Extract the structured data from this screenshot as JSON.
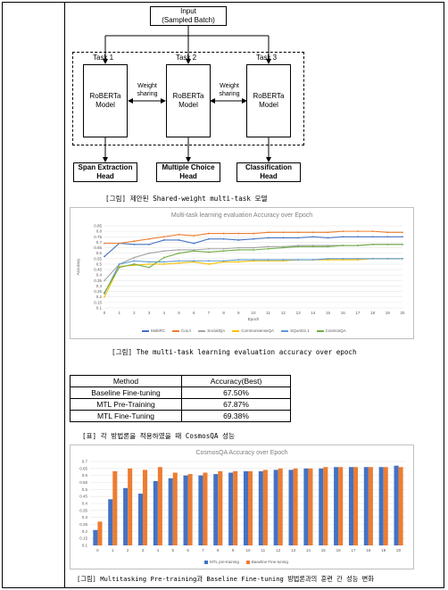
{
  "diagram": {
    "input_label": "Input\n(Sampled Batch)",
    "tasks": [
      {
        "task_label": "Task 1",
        "model_label": "RoBERTa\nModel",
        "head_label": "Span Extraction\nHead"
      },
      {
        "task_label": "Task 2",
        "model_label": "RoBERTa\nModel",
        "head_label": "Multiple Choice\nHead"
      },
      {
        "task_label": "Task 3",
        "model_label": "RoBERTa\nModel",
        "head_label": "Classification\nHead"
      }
    ],
    "weight_sharing_label": "Weight\nsharing",
    "caption": "[그림] 제안된 Shared-weight multi-task 모델"
  },
  "chart1_caption": "[그림] The multi-task learning evaluation accuracy over epoch",
  "table": {
    "headers": [
      "Method",
      "Accuracy(Best)"
    ],
    "rows": [
      [
        "Baseline Fine-tuning",
        "67.50%"
      ],
      [
        "MTL Pre-Training",
        "67.87%"
      ],
      [
        "MTL Fine-Tuning",
        "69.38%"
      ]
    ],
    "caption": "[표] 각 방법론을 적용하였을 때 CosmosQA 성능"
  },
  "chart2_caption": "[그림] Multitasking Pre-training과 Baseline Fine-tuning 방법론과의 훈련 간 성능 변화",
  "chart_data": [
    {
      "type": "line",
      "title": "Multi-task learning evaluation Accuracy over Epoch",
      "xlabel": "Epoch",
      "ylabel": "Accuracy",
      "x": [
        0,
        1,
        2,
        3,
        4,
        5,
        6,
        7,
        8,
        9,
        10,
        11,
        12,
        13,
        14,
        15,
        16,
        17,
        18,
        19,
        20
      ],
      "ylim": [
        0.1,
        0.85
      ],
      "yticks": [
        0.1,
        0.15,
        0.2,
        0.25,
        0.3,
        0.35,
        0.4,
        0.45,
        0.5,
        0.55,
        0.6,
        0.65,
        0.7,
        0.75,
        0.8,
        0.85
      ],
      "grid": true,
      "legend": "bottom",
      "series": [
        {
          "name": "MultiRC",
          "color": "#4472c4",
          "values": [
            0.57,
            0.69,
            0.68,
            0.68,
            0.72,
            0.72,
            0.69,
            0.73,
            0.73,
            0.72,
            0.73,
            0.74,
            0.74,
            0.74,
            0.75,
            0.74,
            0.75,
            0.75,
            0.75,
            0.75,
            0.75
          ]
        },
        {
          "name": "CoLA",
          "color": "#ed7d31",
          "values": [
            0.69,
            0.69,
            0.71,
            0.73,
            0.75,
            0.77,
            0.76,
            0.78,
            0.78,
            0.78,
            0.78,
            0.79,
            0.79,
            0.79,
            0.79,
            0.79,
            0.8,
            0.8,
            0.8,
            0.79,
            0.79
          ]
        },
        {
          "name": "SocialIQA",
          "color": "#a5a5a5",
          "values": [
            0.35,
            0.5,
            0.56,
            0.6,
            0.62,
            0.63,
            0.63,
            0.64,
            0.64,
            0.65,
            0.65,
            0.66,
            0.66,
            0.67,
            0.67,
            0.67,
            0.67,
            0.67,
            0.68,
            0.68,
            0.68
          ]
        },
        {
          "name": "CommonsenseQA",
          "color": "#ffc000",
          "values": [
            0.2,
            0.48,
            0.49,
            0.5,
            0.5,
            0.51,
            0.52,
            0.5,
            0.52,
            0.52,
            0.53,
            0.53,
            0.53,
            0.54,
            0.54,
            0.54,
            0.54,
            0.54,
            0.55,
            0.55,
            0.55
          ]
        },
        {
          "name": "SQuAD2.1",
          "color": "#5b9bd5",
          "values": [
            0.23,
            0.5,
            0.53,
            0.52,
            0.52,
            0.53,
            0.53,
            0.53,
            0.53,
            0.54,
            0.54,
            0.54,
            0.54,
            0.54,
            0.54,
            0.55,
            0.55,
            0.55,
            0.55,
            0.55,
            0.55
          ]
        },
        {
          "name": "CosmosQA",
          "color": "#70ad47",
          "values": [
            0.24,
            0.47,
            0.5,
            0.47,
            0.56,
            0.6,
            0.62,
            0.61,
            0.62,
            0.63,
            0.63,
            0.64,
            0.65,
            0.66,
            0.66,
            0.66,
            0.67,
            0.67,
            0.68,
            0.68,
            0.68
          ]
        }
      ]
    },
    {
      "type": "bar",
      "title": "CosmosQA Accuracy over Epoch",
      "categories": [
        "0",
        "1",
        "2",
        "3",
        "4",
        "5",
        "6",
        "7",
        "8",
        "9",
        "10",
        "11",
        "12",
        "13",
        "14",
        "15",
        "16",
        "17",
        "18",
        "19",
        "20"
      ],
      "ylim": [
        0.1,
        0.7
      ],
      "yticks": [
        0.1,
        0.15,
        0.2,
        0.25,
        0.3,
        0.35,
        0.4,
        0.45,
        0.5,
        0.55,
        0.6,
        0.65,
        0.7
      ],
      "grid": true,
      "legend": "bottom",
      "series": [
        {
          "name": "MTL pre-training",
          "color": "#4472c4",
          "values": [
            0.21,
            0.43,
            0.51,
            0.47,
            0.56,
            0.58,
            0.6,
            0.6,
            0.61,
            0.62,
            0.63,
            0.63,
            0.64,
            0.64,
            0.65,
            0.65,
            0.66,
            0.66,
            0.66,
            0.66,
            0.67
          ]
        },
        {
          "name": "Baseline Fine-tuning",
          "color": "#ed7d31",
          "values": [
            0.27,
            0.63,
            0.65,
            0.64,
            0.66,
            0.62,
            0.61,
            0.62,
            0.63,
            0.63,
            0.63,
            0.64,
            0.65,
            0.65,
            0.65,
            0.66,
            0.66,
            0.66,
            0.66,
            0.66,
            0.66
          ]
        }
      ]
    }
  ]
}
